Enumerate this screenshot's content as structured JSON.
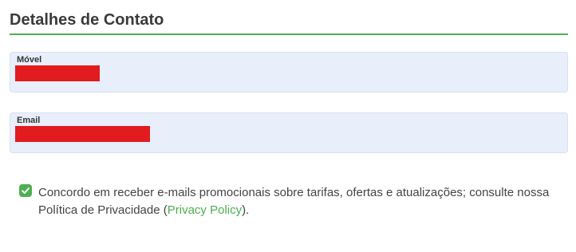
{
  "section": {
    "title": "Detalhes de Contato"
  },
  "fields": {
    "mobile": {
      "label": "Móvel",
      "value": "[redacted]"
    },
    "email": {
      "label": "Email",
      "value": "[redacted]"
    }
  },
  "consent": {
    "checked": true,
    "text_before": "Concordo em receber e-mails promocionais sobre tarifas, ofertas e atualizações; consulte nossa Política de Privacidade (",
    "link_label": "Privacy Policy",
    "text_after": ")."
  },
  "colors": {
    "accent": "#4caf50",
    "field_background": "#e8effb",
    "redaction": "#e21b1f"
  },
  "icons": {
    "consent_checkbox": "check-circle-icon"
  }
}
